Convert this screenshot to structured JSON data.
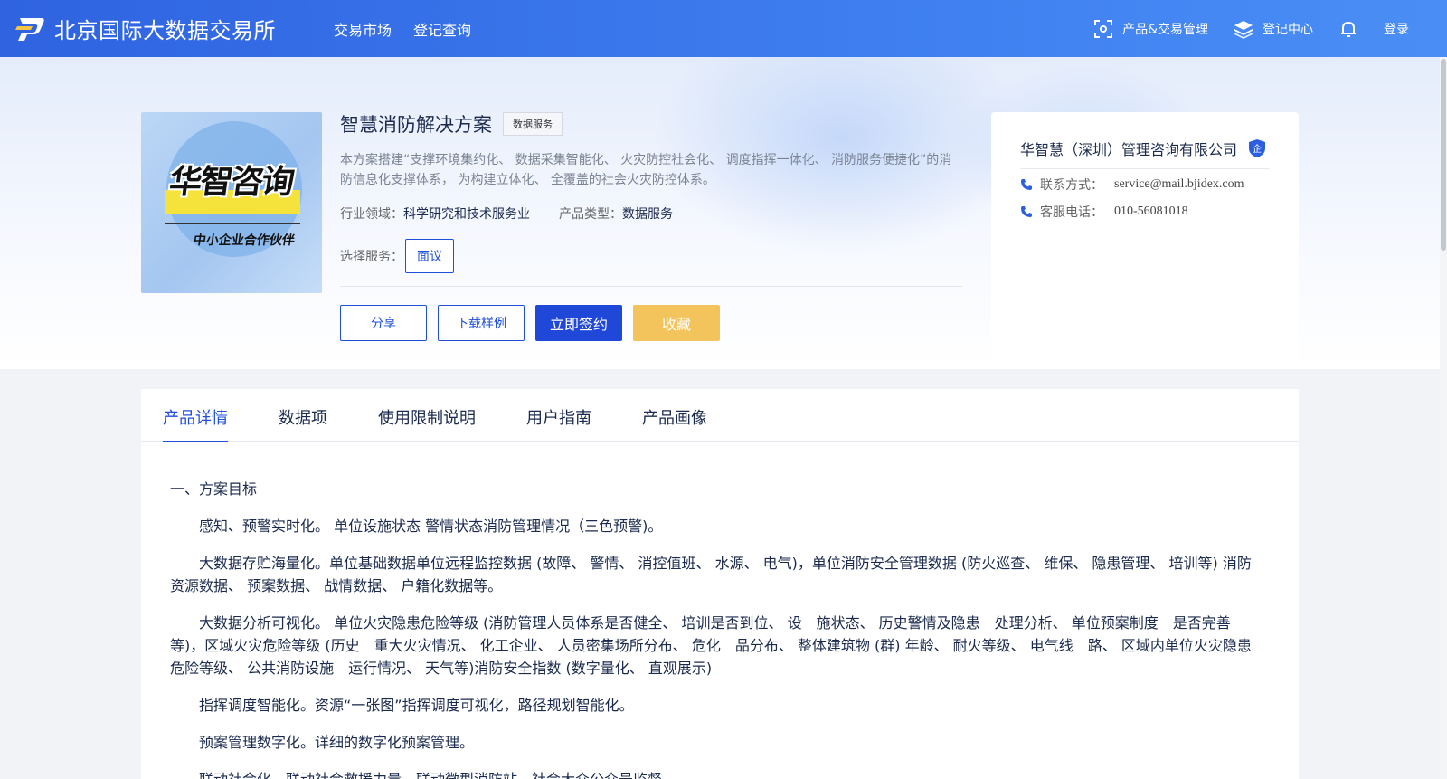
{
  "header": {
    "brand": "北京国际大数据交易所",
    "nav": [
      "交易市场",
      "登记查询"
    ],
    "right": {
      "product_mgmt": "产品&交易管理",
      "register_center": "登记中心",
      "login": "登录"
    }
  },
  "product": {
    "cover_text_main": "华智咨询",
    "cover_text_sub": "中小企业合作伙伴",
    "title": "智慧消防解决方案",
    "tag": "数据服务",
    "description": "本方案搭建“支撑环境集约化、 数据采集智能化、 火灾防控社会化、 调度指挥一体化、 消防服务便捷化”的消防信息化支撑体系， 为构建立体化、 全覆盖的社会火灾防控体系。",
    "industry_label": "行业领域：",
    "industry_value": "科学研究和技术服务业",
    "type_label": "产品类型：",
    "type_value": "数据服务",
    "service_label": "选择服务：",
    "service_option": "面议",
    "buttons": {
      "share": "分享",
      "download": "下载样例",
      "sign": "立即签约",
      "favorite": "收藏"
    }
  },
  "company": {
    "name": "华智慧（深圳）管理咨询有限公司",
    "badge": "企",
    "contact_label": "联系方式：",
    "contact_value": "service@mail.bjidex.com",
    "phone_label": "客服电话：",
    "phone_value": "010-56081018"
  },
  "tabs": [
    "产品详情",
    "数据项",
    "使用限制说明",
    "用户指南",
    "产品画像"
  ],
  "active_tab": "产品详情",
  "article": {
    "heading": "一、方案目标",
    "paragraphs": [
      "感知、预警实时化。 单位设施状态 警情状态消防管理情况（三色预警)。",
      "大数据存贮海量化。单位基础数据单位远程监控数据 (故障、 警情、 消控值班、 水源、 电气)，单位消防安全管理数据 (防火巡查、 维保、 隐患管理、 培训等) 消防资源数据、 预案数据、 战情数据、 户籍化数据等。",
      "大数据分析可视化。 单位火灾隐患危险等级 (消防管理人员体系是否健全、 培训是否到位、 设　施状态、 历史警情及隐患　处理分析、 单位预案制度　是否完善等)，区域火灾危险等级 (历史　重大火灾情况、 化工企业、 人员密集场所分布、 危化　品分布、 整体建筑物 (群) 年龄、 耐火等级、 电气线　路、 区域内单位火灾隐患　危险等级、 公共消防设施　运行情况、 天气等)消防安全指数 (数字量化、 直观展示)",
      "指挥调度智能化。资源“一张图”指挥调度可视化，路径规划智能化。",
      "预案管理数字化。详细的数字化预案管理。",
      "联动社会化。联动社会救援力量，联动微型消防站，社会大众公众号监督。"
    ]
  },
  "colors": {
    "header_blue": "#2f63e0",
    "primary": "#1f48d8",
    "favorite": "#f3c35c"
  }
}
